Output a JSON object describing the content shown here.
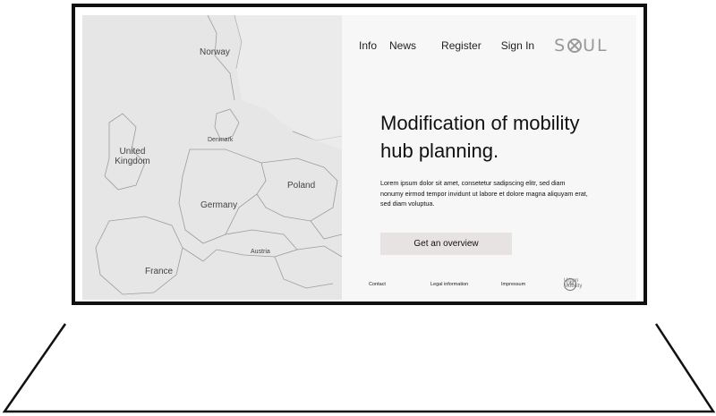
{
  "map": {
    "labels": {
      "norway": "Norway",
      "united_kingdom": "United\nKingdom",
      "denmark": "Denmark",
      "poland": "Poland",
      "germany": "Germany",
      "austria": "Austria",
      "france": "France"
    }
  },
  "nav": {
    "items": [
      "Info",
      "News",
      "Register",
      "Sign In"
    ],
    "logo": {
      "left": "S",
      "right": "UL",
      "icon": "cross-circle-icon"
    }
  },
  "hero": {
    "headline": "Modification of mobility hub planning.",
    "body": "Lorem ipsum dolor sit amet, consetetur sadipscing elitr, sed diam nonumy eirmod tempor invidunt ut labore et dolore magna aliquyam erat, sed diam voluptua.",
    "cta": "Get an overview"
  },
  "footer": {
    "contact": "Contact",
    "legal": "Legal information",
    "impressum": "Impressum",
    "urban_mobility": "Urban Mobility",
    "urban_mobility_mark": "UM"
  },
  "colors": {
    "map_bg": "#e6e6e6",
    "panel_bg": "#f7f7f7",
    "cta_bg": "#e7e3e2",
    "logo": "#9a9a9a"
  }
}
